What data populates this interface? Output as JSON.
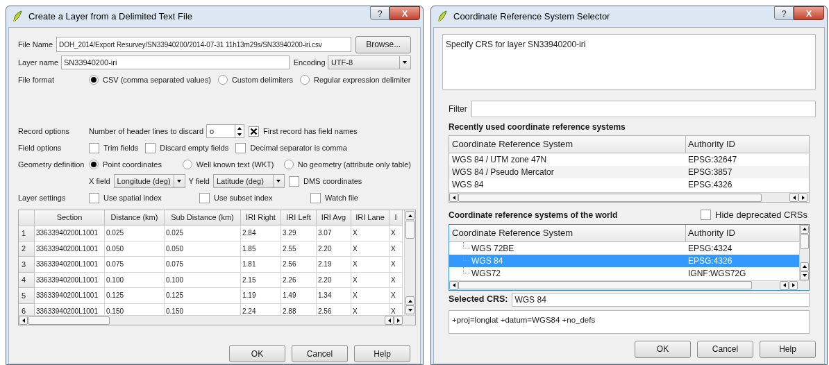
{
  "delimited_dialog": {
    "title": "Create a Layer from a Delimited Text File",
    "help_button": "?",
    "close_button": "X",
    "file_name": {
      "label": "File Name",
      "value": "DOH_2014/Export Resurvey/SN33940200/2014-07-31 11h13m29s/SN33940200-iri.csv"
    },
    "browse_button": "Browse...",
    "layer_name": {
      "label": "Layer name",
      "value": "SN33940200-iri"
    },
    "encoding": {
      "label": "Encoding",
      "value": "UTF-8"
    },
    "file_format": {
      "label": "File format",
      "options": [
        {
          "label": "CSV (comma separated values)",
          "selected": true
        },
        {
          "label": "Custom delimiters",
          "selected": false
        },
        {
          "label": "Regular expression delimiter",
          "selected": false
        }
      ]
    },
    "record_options": {
      "label": "Record options",
      "header_lines_label": "Number of header lines to discard",
      "header_lines_value": "o",
      "first_record": {
        "label": "First record has field names",
        "checked": true
      }
    },
    "field_options": {
      "label": "Field options",
      "checkboxes": [
        {
          "label": "Trim fields",
          "checked": false
        },
        {
          "label": "Discard empty fields",
          "checked": false
        },
        {
          "label": "Decimal separator is comma",
          "checked": false
        }
      ]
    },
    "geometry_definition": {
      "label": "Geometry definition",
      "options": [
        {
          "label": "Point coordinates",
          "selected": true
        },
        {
          "label": "Well known text (WKT)",
          "selected": false
        },
        {
          "label": "No geometry (attribute only table)",
          "selected": false
        }
      ],
      "x_field": {
        "label": "X field",
        "value": "Longitude (deg)"
      },
      "y_field": {
        "label": "Y field",
        "value": "Latitude (deg)"
      },
      "dms": {
        "label": "DMS coordinates",
        "checked": false
      }
    },
    "layer_settings": {
      "label": "Layer settings",
      "checkboxes": [
        {
          "label": "Use spatial index",
          "checked": false
        },
        {
          "label": "Use subset index",
          "checked": false
        },
        {
          "label": "Watch file",
          "checked": false
        }
      ]
    },
    "table": {
      "columns": [
        "Section",
        "Distance (km)",
        "Sub Distance (km)",
        "IRI Right",
        "IRI Left",
        "IRI Avg",
        "IRI Lane",
        "I"
      ],
      "rows": [
        {
          "number": "1",
          "cells": [
            "33633940200L1001",
            "0.025",
            "0.025",
            "2.84",
            "3.29",
            "3.07",
            "X",
            "X"
          ]
        },
        {
          "number": "2",
          "cells": [
            "33633940200L1001",
            "0.050",
            "0.050",
            "1.85",
            "2.55",
            "2.20",
            "X",
            "X"
          ]
        },
        {
          "number": "3",
          "cells": [
            "33633940200L1001",
            "0.075",
            "0.075",
            "1.81",
            "2.56",
            "2.19",
            "X",
            "X"
          ]
        },
        {
          "number": "4",
          "cells": [
            "33633940200L1001",
            "0.100",
            "0.100",
            "2.15",
            "2.26",
            "2.20",
            "X",
            "X"
          ]
        },
        {
          "number": "5",
          "cells": [
            "33633940200L1001",
            "0.125",
            "0.125",
            "1.19",
            "1.49",
            "1.34",
            "X",
            "X"
          ]
        },
        {
          "number": "6",
          "cells": [
            "33633940200L1001",
            "0.150",
            "0.150",
            "2.24",
            "2.88",
            "2.56",
            "X",
            "X"
          ]
        }
      ]
    },
    "buttons": [
      "OK",
      "Cancel",
      "Help"
    ]
  },
  "crs_dialog": {
    "title": "Coordinate Reference System Selector",
    "help_button": "?",
    "close_button": "X",
    "description": "Specify CRS for layer SN33940200-iri",
    "filter": {
      "label": "Filter"
    },
    "recent": {
      "heading": "Recently used coordinate reference systems",
      "columns": [
        "Coordinate Reference System",
        "Authority ID"
      ],
      "rows": [
        {
          "name": "WGS 84 / UTM zone 47N",
          "authority_id": "EPSG:32647"
        },
        {
          "name": "WGS 84 / Pseudo Mercator",
          "authority_id": "EPSG:3857"
        },
        {
          "name": "WGS 84",
          "authority_id": "EPSG:4326"
        }
      ]
    },
    "world": {
      "heading": "Coordinate reference systems of the world",
      "hide_deprecated": {
        "label": "Hide deprecated CRSs",
        "checked": false
      },
      "columns": [
        "Coordinate Reference System",
        "Authority ID"
      ],
      "rows": [
        {
          "name": "WGS 72BE",
          "authority_id": "EPSG:4324",
          "selected": false
        },
        {
          "name": "WGS 84",
          "authority_id": "EPSG:4326",
          "selected": true
        },
        {
          "name": "WGS72",
          "authority_id": "IGNF:WGS72G",
          "selected": false
        }
      ]
    },
    "selected_crs": {
      "label": "Selected CRS:",
      "value": "WGS 84"
    },
    "proj_string": "+proj=longlat +datum=WGS84 +no_defs",
    "buttons": [
      "OK",
      "Cancel",
      "Help"
    ]
  }
}
